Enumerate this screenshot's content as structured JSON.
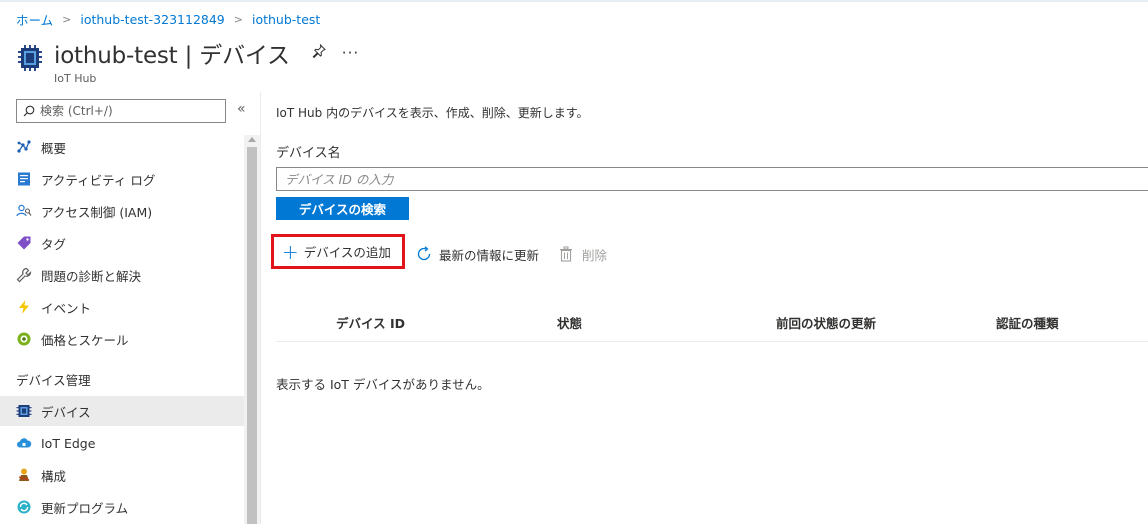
{
  "breadcrumb": {
    "items": [
      "ホーム",
      "iothub-test-323112849",
      "iothub-test"
    ]
  },
  "header": {
    "title": "iothub-test | デバイス",
    "subtitle": "IoT Hub",
    "pin_icon": "pin-icon",
    "more_label": "···"
  },
  "sidebar": {
    "search_placeholder": "検索 (Ctrl+/)",
    "collapse_label": "«",
    "items": [
      {
        "label": "概要",
        "icon": "overview-icon"
      },
      {
        "label": "アクティビティ ログ",
        "icon": "activity-log-icon"
      },
      {
        "label": "アクセス制御 (IAM)",
        "icon": "iam-icon"
      },
      {
        "label": "タグ",
        "icon": "tag-icon"
      },
      {
        "label": "問題の診断と解決",
        "icon": "wrench-icon"
      },
      {
        "label": "イベント",
        "icon": "lightning-icon"
      },
      {
        "label": "価格とスケール",
        "icon": "pricing-icon"
      }
    ],
    "section_title": "デバイス管理",
    "section_items": [
      {
        "label": "デバイス",
        "icon": "chip-icon",
        "active": true
      },
      {
        "label": "IoT Edge",
        "icon": "cloud-icon"
      },
      {
        "label": "構成",
        "icon": "configuration-icon"
      },
      {
        "label": "更新プログラム",
        "icon": "update-icon"
      }
    ]
  },
  "main": {
    "description": "IoT Hub 内のデバイスを表示、作成、削除、更新します。",
    "field_label": "デバイス名",
    "field_placeholder": "デバイス ID の入力",
    "search_button": "デバイスの検索",
    "toolbar": {
      "add": "デバイスの追加",
      "refresh": "最新の情報に更新",
      "delete": "削除"
    },
    "columns": [
      "デバイス ID",
      "状態",
      "前回の状態の更新",
      "認証の種類"
    ],
    "empty_message": "表示する IoT デバイスがありません。"
  },
  "colors": {
    "accent": "#0078d4",
    "highlight_border": "#e2141b"
  }
}
